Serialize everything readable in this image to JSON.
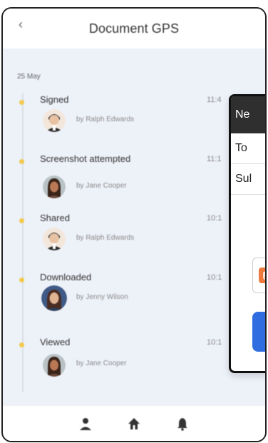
{
  "header": {
    "title": "Document GPS"
  },
  "timeline": {
    "date": "25 May",
    "events": [
      {
        "title": "Signed",
        "time": "11:4",
        "by": "by Ralph Edwards"
      },
      {
        "title": "Screenshot attempted",
        "time": "11:1",
        "by": "by Jane Cooper"
      },
      {
        "title": "Shared",
        "time": "10:1",
        "by": "by Ralph Edwards"
      },
      {
        "title": "Downloaded",
        "time": "10:1",
        "by": "by Jenny Wilson"
      },
      {
        "title": "Viewed",
        "time": "10:1",
        "by": "by Jane Cooper"
      }
    ]
  },
  "modal": {
    "title": "Ne",
    "to_label": "To",
    "subject_label": "Sul"
  },
  "colors": {
    "timeline_dot": "#f2c94c",
    "content_bg": "#edf1f8",
    "modal_header": "#2f2f2f",
    "send_button": "#2f6de0",
    "attachment_icon": "#ee7a3e"
  },
  "icons": {
    "back": "chevron-left-icon",
    "nav": [
      "user-icon",
      "home-icon",
      "bell-icon"
    ],
    "attachment": "paperclip-icon"
  }
}
